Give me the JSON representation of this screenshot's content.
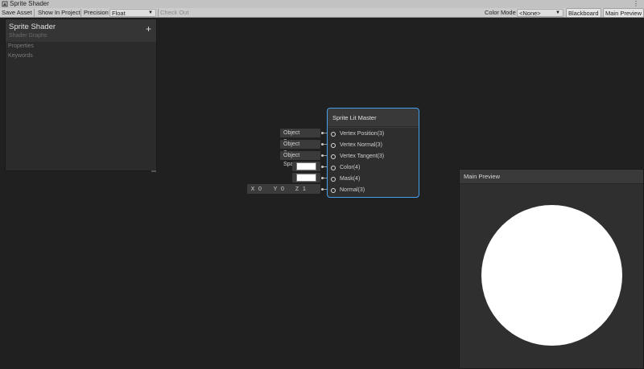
{
  "window": {
    "title": "Sprite Shader",
    "icon": "unity-shader-icon",
    "menu_icon": "kebab-menu-icon"
  },
  "toolbar": {
    "save_asset": "Save Asset",
    "show_in_project": "Show In Project",
    "precision_label": "Precision",
    "precision_value": "Float",
    "check_out": "Check Out",
    "color_mode_label": "Color Mode",
    "color_mode_value": "<None>",
    "blackboard": "Blackboard",
    "main_preview": "Main Preview"
  },
  "blackboard": {
    "title": "Sprite Shader",
    "subtitle": "Shader Graphs",
    "add": "+",
    "sections": [
      "Properties",
      "Keywords"
    ]
  },
  "master_node": {
    "title": "Sprite Lit Master",
    "ports": [
      {
        "label": "Vertex Position(3)",
        "input": "Object Space"
      },
      {
        "label": "Vertex Normal(3)",
        "input": "Object Space"
      },
      {
        "label": "Vertex Tangent(3)",
        "input": "Object Space"
      },
      {
        "label": "Color(4)",
        "input_color": "#ffffff"
      },
      {
        "label": "Mask(4)",
        "input_color": "#ffffff"
      },
      {
        "label": "Normal(3)",
        "vector": {
          "x_label": "X",
          "x": "0",
          "y_label": "Y",
          "y": "0",
          "z_label": "Z",
          "z": "1"
        }
      }
    ]
  },
  "main_preview": {
    "title": "Main Preview",
    "sphere_color": "#ffffff"
  },
  "colors": {
    "selection_outline": "#44a0ee",
    "canvas": "#202020"
  }
}
